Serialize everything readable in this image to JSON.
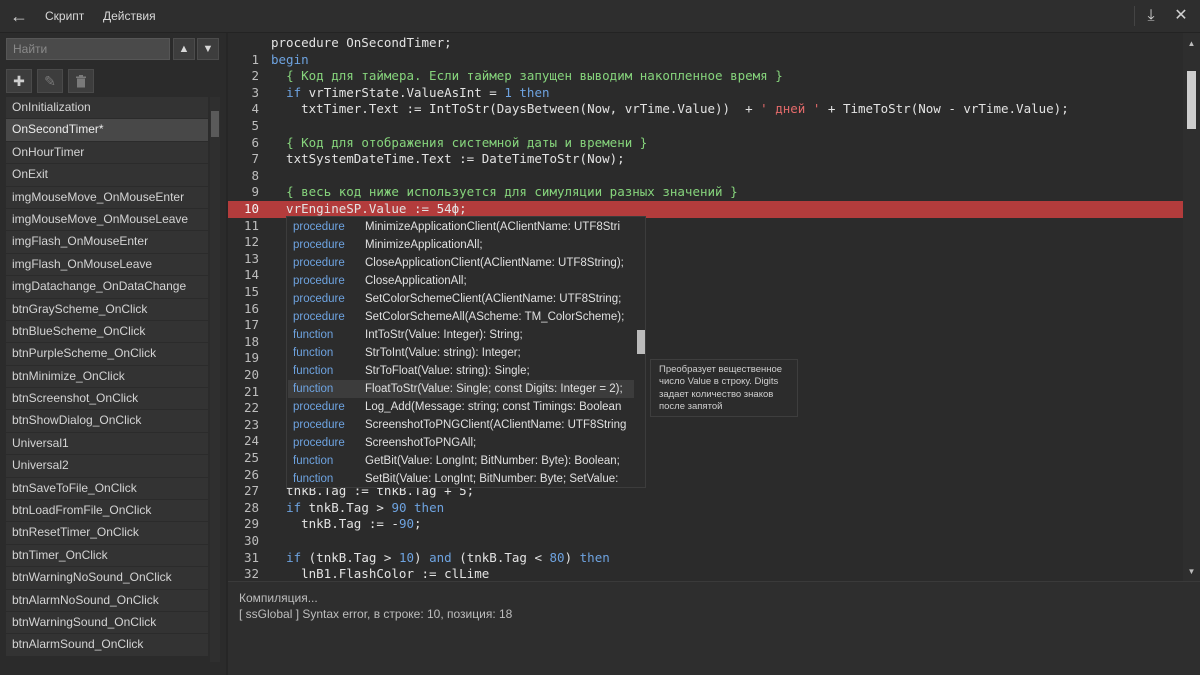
{
  "toolbar": {
    "menu_script": "Скрипт",
    "menu_actions": "Действия"
  },
  "sidebar": {
    "search_placeholder": "Найти",
    "items": [
      {
        "label": "OnInitialization",
        "selected": false
      },
      {
        "label": "OnSecondTimer*",
        "selected": true
      },
      {
        "label": "OnHourTimer",
        "selected": false
      },
      {
        "label": "OnExit",
        "selected": false
      },
      {
        "label": "imgMouseMove_OnMouseEnter",
        "selected": false
      },
      {
        "label": "imgMouseMove_OnMouseLeave",
        "selected": false
      },
      {
        "label": "imgFlash_OnMouseEnter",
        "selected": false
      },
      {
        "label": "imgFlash_OnMouseLeave",
        "selected": false
      },
      {
        "label": "imgDatachange_OnDataChange",
        "selected": false
      },
      {
        "label": "btnGrayScheme_OnClick",
        "selected": false
      },
      {
        "label": "btnBlueScheme_OnClick",
        "selected": false
      },
      {
        "label": "btnPurpleScheme_OnClick",
        "selected": false
      },
      {
        "label": "btnMinimize_OnClick",
        "selected": false
      },
      {
        "label": "btnScreenshot_OnClick",
        "selected": false
      },
      {
        "label": "btnShowDialog_OnClick",
        "selected": false
      },
      {
        "label": "Universal1",
        "selected": false
      },
      {
        "label": "Universal2",
        "selected": false
      },
      {
        "label": "btnSaveToFile_OnClick",
        "selected": false
      },
      {
        "label": "btnLoadFromFile_OnClick",
        "selected": false
      },
      {
        "label": "btnResetTimer_OnClick",
        "selected": false
      },
      {
        "label": "btnTimer_OnClick",
        "selected": false
      },
      {
        "label": "btnWarningNoSound_OnClick",
        "selected": false
      },
      {
        "label": "btnAlarmNoSound_OnClick",
        "selected": false
      },
      {
        "label": "btnWarningSound_OnClick",
        "selected": false
      },
      {
        "label": "btnAlarmSound_OnClick",
        "selected": false
      }
    ]
  },
  "editor": {
    "lines": [
      {
        "num": "",
        "segs": [
          [
            "t",
            "procedure OnSecondTimer;"
          ]
        ]
      },
      {
        "num": "1",
        "segs": [
          [
            "k",
            "begin"
          ]
        ]
      },
      {
        "num": "2",
        "segs": [
          [
            "t",
            "  "
          ],
          [
            "c",
            "{ Код для таймера. Если таймер запущен выводим накопленное время }"
          ]
        ]
      },
      {
        "num": "3",
        "segs": [
          [
            "t",
            "  "
          ],
          [
            "k",
            "if"
          ],
          [
            "t",
            " vrTimerState.ValueAsInt = "
          ],
          [
            "n",
            "1"
          ],
          [
            "t",
            " "
          ],
          [
            "k",
            "then"
          ]
        ]
      },
      {
        "num": "4",
        "segs": [
          [
            "t",
            "    txtTimer.Text := IntToStr(DaysBetween(Now, vrTime.Value))  + "
          ],
          [
            "s",
            "' дней '"
          ],
          [
            "t",
            " + TimeToStr(Now - vrTime.Value);"
          ]
        ]
      },
      {
        "num": "5",
        "segs": []
      },
      {
        "num": "6",
        "segs": [
          [
            "t",
            "  "
          ],
          [
            "c",
            "{ Код для отображения системной даты и времени }"
          ]
        ]
      },
      {
        "num": "7",
        "segs": [
          [
            "t",
            "  txtSystemDateTime.Text := DateTimeToStr(Now);"
          ]
        ]
      },
      {
        "num": "8",
        "segs": []
      },
      {
        "num": "9",
        "segs": [
          [
            "t",
            "  "
          ],
          [
            "c",
            "{ весь код ниже используется для симуляции разных значений }"
          ]
        ]
      },
      {
        "num": "10",
        "error": true,
        "segs": [
          [
            "t",
            "  vrEngineSP.Value := 54ф;"
          ]
        ]
      },
      {
        "num": "11",
        "segs": []
      },
      {
        "num": "12",
        "segs": []
      },
      {
        "num": "13",
        "segs": []
      },
      {
        "num": "14",
        "segs": []
      },
      {
        "num": "15",
        "segs": []
      },
      {
        "num": "16",
        "segs": []
      },
      {
        "num": "17",
        "segs": []
      },
      {
        "num": "18",
        "segs": []
      },
      {
        "num": "19",
        "segs": []
      },
      {
        "num": "20",
        "segs": []
      },
      {
        "num": "21",
        "segs": []
      },
      {
        "num": "22",
        "segs": []
      },
      {
        "num": "23",
        "segs": []
      },
      {
        "num": "24",
        "segs": []
      },
      {
        "num": "25",
        "segs": []
      },
      {
        "num": "26",
        "segs": []
      },
      {
        "num": "27",
        "segs": [
          [
            "t",
            "  tnkB.Tag := tnkB.Tag + 5;"
          ]
        ]
      },
      {
        "num": "28",
        "segs": [
          [
            "t",
            "  "
          ],
          [
            "k",
            "if"
          ],
          [
            "t",
            " tnkB.Tag > "
          ],
          [
            "n",
            "90"
          ],
          [
            "t",
            " "
          ],
          [
            "k",
            "then"
          ]
        ]
      },
      {
        "num": "29",
        "segs": [
          [
            "t",
            "    tnkB.Tag := -"
          ],
          [
            "n",
            "90"
          ],
          [
            "t",
            ";"
          ]
        ]
      },
      {
        "num": "30",
        "segs": []
      },
      {
        "num": "31",
        "segs": [
          [
            "t",
            "  "
          ],
          [
            "k",
            "if"
          ],
          [
            "t",
            " (tnkB.Tag > "
          ],
          [
            "n",
            "10"
          ],
          [
            "t",
            ") "
          ],
          [
            "k",
            "and"
          ],
          [
            "t",
            " (tnkB.Tag < "
          ],
          [
            "n",
            "80"
          ],
          [
            "t",
            ") "
          ],
          [
            "k",
            "then"
          ]
        ]
      },
      {
        "num": "32",
        "segs": [
          [
            "t",
            "    lnB1.FlashColor := clLime"
          ]
        ]
      }
    ]
  },
  "autocomplete": {
    "items": [
      {
        "kind": "procedure",
        "sig": "MinimizeApplicationClient(AClientName: UTF8Stri",
        "selected": false
      },
      {
        "kind": "procedure",
        "sig": "MinimizeApplicationAll;",
        "selected": false
      },
      {
        "kind": "procedure",
        "sig": "CloseApplicationClient(AClientName: UTF8String);",
        "selected": false
      },
      {
        "kind": "procedure",
        "sig": "CloseApplicationAll;",
        "selected": false
      },
      {
        "kind": "procedure",
        "sig": "SetColorSchemeClient(AClientName: UTF8String;",
        "selected": false
      },
      {
        "kind": "procedure",
        "sig": "SetColorSchemeAll(AScheme: TM_ColorScheme);",
        "selected": false
      },
      {
        "kind": "function",
        "sig": "IntToStr(Value: Integer): String;",
        "selected": false
      },
      {
        "kind": "function",
        "sig": "StrToInt(Value: string): Integer;",
        "selected": false
      },
      {
        "kind": "function",
        "sig": "StrToFloat(Value: string): Single;",
        "selected": false
      },
      {
        "kind": "function",
        "sig": "FloatToStr(Value: Single; const Digits: Integer = 2);",
        "selected": true
      },
      {
        "kind": "procedure",
        "sig": "Log_Add(Message: string; const Timings: Boolean",
        "selected": false
      },
      {
        "kind": "procedure",
        "sig": "ScreenshotToPNGClient(AClientName: UTF8String",
        "selected": false
      },
      {
        "kind": "procedure",
        "sig": "ScreenshotToPNGAll;",
        "selected": false
      },
      {
        "kind": "function",
        "sig": "GetBit(Value: LongInt; BitNumber: Byte): Boolean;",
        "selected": false
      },
      {
        "kind": "function",
        "sig": "SetBit(Value: LongInt; BitNumber: Byte; SetValue:",
        "selected": false
      }
    ]
  },
  "tooltip": {
    "text": "Преобразует вещественное число Value в строку. Digits задает количество знаков после запятой"
  },
  "output": {
    "line1": "Компиляция...",
    "line2": "[ ssGlobal ] Syntax error, в строке: 10, позиция: 18"
  },
  "colors": {
    "keyword": "#6ea3e0",
    "comment": "#86d47c",
    "string": "#e36a6a",
    "error_line": "#b33c3c",
    "background": "#2b2b2b"
  },
  "icons": {
    "back": "arrow-left-icon",
    "prev": "chevron-up-icon",
    "next": "chevron-down-icon",
    "add": "plus-icon",
    "edit": "pencil-icon",
    "delete": "trash-icon",
    "download": "download-icon",
    "close": "close-icon"
  }
}
